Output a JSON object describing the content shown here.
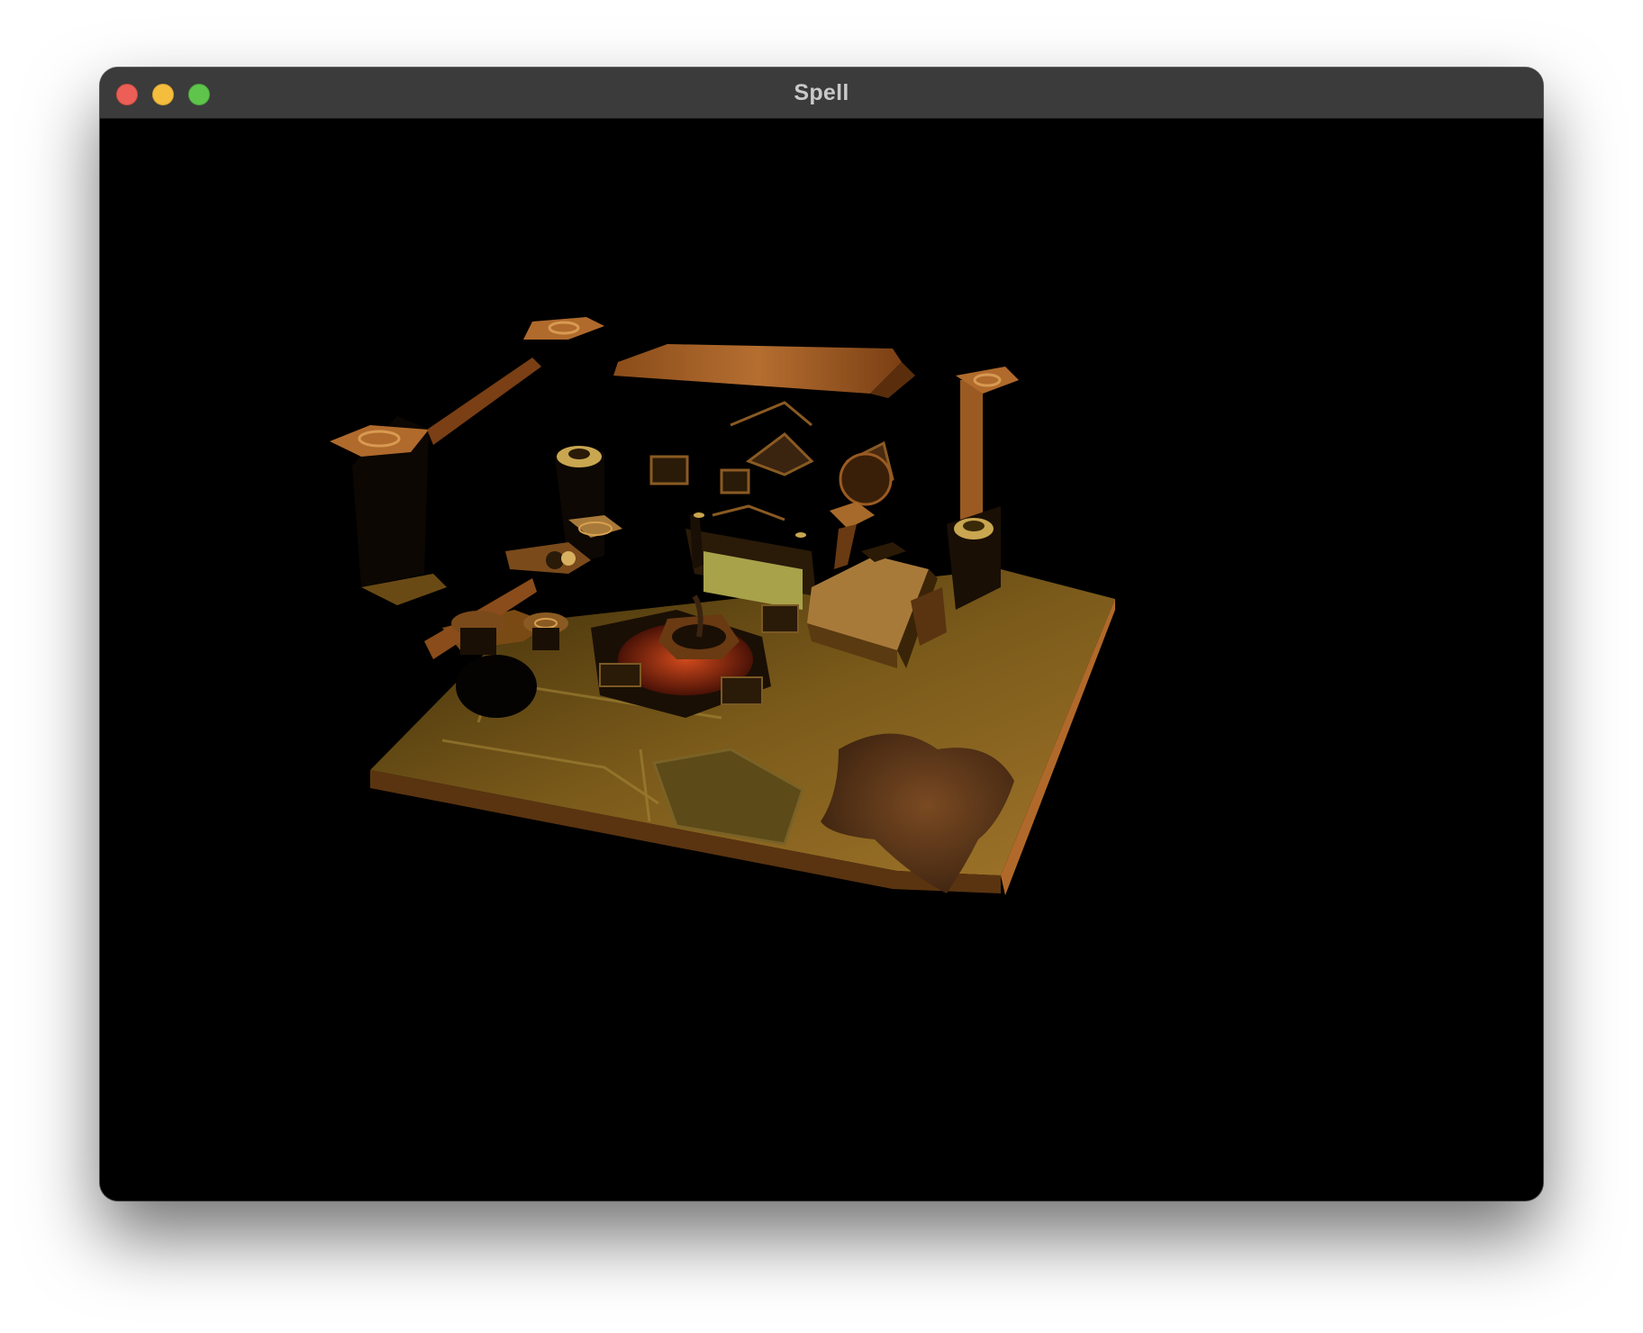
{
  "window": {
    "title": "Spell",
    "controls": {
      "close": "close-button",
      "minimize": "minimize-button",
      "maximize": "maximize-button"
    }
  },
  "scene": {
    "description_name": "isometric-room-scene",
    "background_color": "#000000",
    "palette": {
      "wood_light": "#b06a2c",
      "wood_dark": "#6e3a12",
      "stone": "#8a6a22",
      "rug": "#6a3f1c",
      "cloth_green": "#9a9a45",
      "fire": "#a83a18"
    }
  }
}
